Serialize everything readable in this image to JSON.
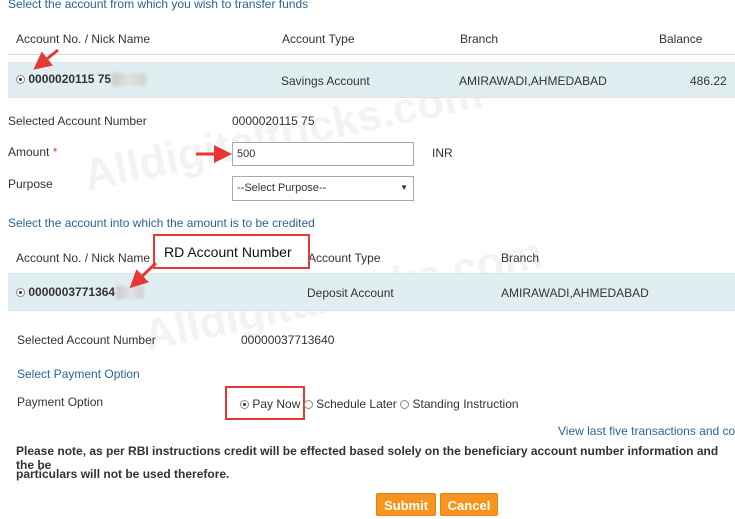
{
  "debit_section": {
    "title": "Select the account from which you wish to transfer funds",
    "headers": {
      "account": "Account No. / Nick Name",
      "type": "Account Type",
      "branch": "Branch",
      "balance": "Balance"
    },
    "row": {
      "account": "0000020115 75",
      "type": "Savings Account",
      "branch": "AMIRAWADI,AHMEDABAD",
      "balance": "486.22"
    }
  },
  "selected_debit": {
    "label": "Selected Account Number",
    "value": "0000020115 75"
  },
  "amount": {
    "label": "Amount",
    "required_mark": "*",
    "value": "500",
    "currency": "INR"
  },
  "purpose": {
    "label": "Purpose",
    "selected": "--Select Purpose--"
  },
  "credit_section": {
    "title": "Select the account into which the amount is to be credited",
    "headers": {
      "account": "Account No. / Nick Name",
      "type": "Account Type",
      "branch": "Branch"
    },
    "row": {
      "account": "0000003771364",
      "type": "Deposit Account",
      "branch": "AMIRAWADI,AHMEDABAD"
    }
  },
  "callout": {
    "text": "RD Account Number"
  },
  "selected_credit": {
    "label": "Selected Account Number",
    "value": "00000037713640"
  },
  "payment": {
    "section_title": "Select Payment Option",
    "label": "Payment Option",
    "options": [
      "Pay Now",
      "Schedule Later",
      "Standing Instruction"
    ]
  },
  "view_link": "View last five transactions and cor",
  "note": {
    "line1": "Please note, as per RBI instructions credit will be effected based solely on the beneficiary account number information and the be",
    "line2": "particulars will not be used therefore."
  },
  "buttons": {
    "submit": "Submit",
    "cancel": "Cancel"
  },
  "watermark": "Alldigitaltricks.com",
  "colors": {
    "accent": "#2a6496",
    "button": "#f7941d",
    "highlight_row": "#e0eef2",
    "annotation": "#e53935"
  }
}
